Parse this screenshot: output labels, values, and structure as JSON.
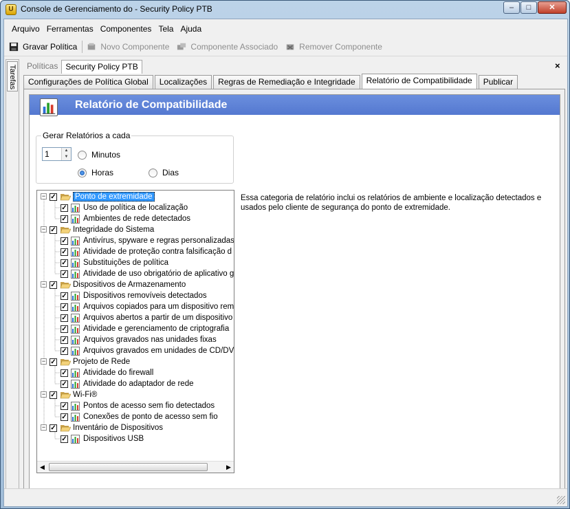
{
  "window": {
    "title": "Console de Gerenciamento do  - Security Policy PTB",
    "minimize": "–",
    "maximize": "□",
    "close": "✕"
  },
  "menu": [
    "Arquivo",
    "Ferramentas",
    "Componentes",
    "Tela",
    "Ajuda"
  ],
  "toolbar": {
    "save": "Gravar Política",
    "new_component": "Novo Componente",
    "associated_component": "Componente Associado",
    "remove_component": "Remover Componente"
  },
  "side_panel": {
    "tab": "Tarefas"
  },
  "panel_close": "×",
  "doc_tabs": [
    "Políticas",
    "Security Policy PTB"
  ],
  "policy_tabs": [
    "Configurações de Política Global",
    "Localizações",
    "Regras de Remediação e Integridade",
    "Relatório de Compatibilidade",
    "Publicar"
  ],
  "report": {
    "title": "Relatório de Compatibilidade",
    "group_label": "Gerar Relatórios a cada",
    "interval_value": "1",
    "options": [
      "Minutos",
      "Horas",
      "Dias"
    ],
    "selected_option": "Horas",
    "description": "Essa categoria de relatório inclui os relatórios de ambiente e localização detectados e usados pelo cliente de segurança do ponto de extremidade."
  },
  "tree": {
    "categories": [
      {
        "label": "Ponto de extremidade",
        "selected": true,
        "children": [
          "Uso de política de localização",
          "Ambientes de rede detectados"
        ]
      },
      {
        "label": "Integridade do Sistema",
        "children": [
          "Antivírus, spyware e regras personalizadas",
          "Atividade de proteção contra falsificação d",
          "Substituições de política",
          "Atividade de uso obrigatório de aplicativo g"
        ]
      },
      {
        "label": "Dispositivos de Armazenamento",
        "children": [
          "Dispositivos removíveis detectados",
          "Arquivos copiados para um dispositivo rem",
          "Arquivos abertos a partir de um dispositivo",
          "Atividade e gerenciamento de criptografia",
          "Arquivos gravados nas unidades fixas",
          "Arquivos gravados em unidades de CD/DV"
        ]
      },
      {
        "label": "Projeto de Rede",
        "children": [
          "Atividade do firewall",
          "Atividade do adaptador de rede"
        ]
      },
      {
        "label": "Wi-Fi®",
        "children": [
          "Pontos de acesso sem fio detectados",
          "Conexões de ponto de acesso sem fio"
        ]
      },
      {
        "label": "Inventário de Dispositivos",
        "children": [
          "Dispositivos USB"
        ]
      }
    ]
  },
  "colors": {
    "header_blue": "#5b7fd6",
    "selection_blue": "#3399ff"
  }
}
